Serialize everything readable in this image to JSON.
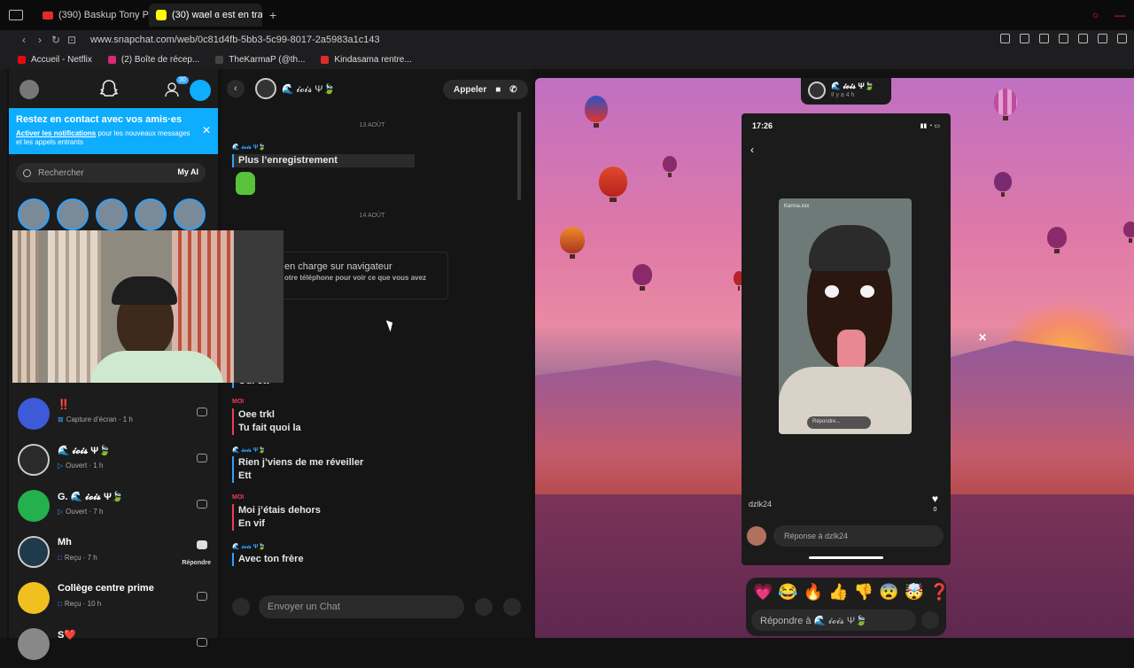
{
  "tabs": [
    {
      "label": "(390) Baskup Tony Parker"
    },
    {
      "label": "(30) wael ɞ est en train d"
    }
  ],
  "address": {
    "url": "www.snapchat.com/web/0c81d4fb-5bb3-5c99-8017-2a5983a1c143"
  },
  "bookmarks": [
    {
      "label": "Accueil - Netflix",
      "color": "#e50914"
    },
    {
      "label": "(2) Boîte de récep...",
      "color": "#d62976"
    },
    {
      "label": "TheKarmaP (@th...",
      "color": "#222222"
    },
    {
      "label": "Kindasama rentre...",
      "color": "#e02b2b"
    }
  ],
  "sidebar": {
    "badge": "30",
    "notif_title": "Restez en contact avec vos amis·es",
    "notif_link": "Activer les notifications",
    "notif_rest": " pour les nouveaux messages et les appels entrants",
    "search_placeholder": "Rechercher",
    "myai_label": "My AI",
    "chats": [
      {
        "name": "‼️",
        "sub": "Capture d’écran · 1 h",
        "avatar_color": "#3d5ad8"
      },
      {
        "name": "🌊 𝓲𝓸𝓲𝓼 Ψ🍃",
        "sub": "Ouvert · 1 h",
        "avatar_color": "#2a2a2a"
      },
      {
        "name": "G. 🌊 𝓲𝓸𝓲𝓼 Ψ🍃",
        "sub": "Ouvert · 7 h",
        "avatar_color": "#23b14d"
      },
      {
        "name": "Mh",
        "sub": "Reçu · 7 h",
        "avatar_color": "#1f3a4a",
        "reply": "Répondre"
      },
      {
        "name": "Collège centre prime",
        "sub": "Reçu · 10 h",
        "avatar_color": "#f0c020"
      },
      {
        "name": "S❤️",
        "sub": "",
        "avatar_color": "#888888"
      }
    ]
  },
  "chat": {
    "contact_name": "🌊 𝓲𝓸𝓲𝓼 Ψ🍃",
    "call_label": "Appeler",
    "date1": "13 AOÛT",
    "date2": "14 AOÛT",
    "them_label": "🌊 𝓲𝓸𝓲𝓼 Ψ🍃",
    "me_label": "MOI",
    "msg_record": "Plus l’enregistrement",
    "browser_title": "en charge sur navigateur",
    "browser_sub": "otre téléphone pour voir ce que vous avez",
    "msg_partial": "Oui ett",
    "msg_me1a": "Oee trkl",
    "msg_me1b": "Tu fait quoi la",
    "msg_them2a": "Rien j’viens de me réveiller",
    "msg_them2b": "Ett",
    "msg_me2a": "Moi j’étais dehors",
    "msg_me2b": "En vif",
    "msg_them3": "Avec ton frère",
    "composer_placeholder": "Envoyer un Chat"
  },
  "viewer": {
    "user_name": "🌊 𝓲𝓸𝓲𝓼 Ψ🍃",
    "time": "Il y a 4 h",
    "phone_time": "17:26",
    "story_user": "Karma.xxx",
    "story_reply": "Répondre...",
    "mention_user": "dzlk24",
    "heart_count": "0",
    "reply_placeholder": "Réponse à dzlk24",
    "react_placeholder": "Répondre à 🌊 𝓲𝓸𝓲𝓼 Ψ🍃",
    "emojis": [
      "💗",
      "😂",
      "🔥",
      "👍",
      "👎",
      "😨",
      "🤯",
      "❓"
    ]
  }
}
